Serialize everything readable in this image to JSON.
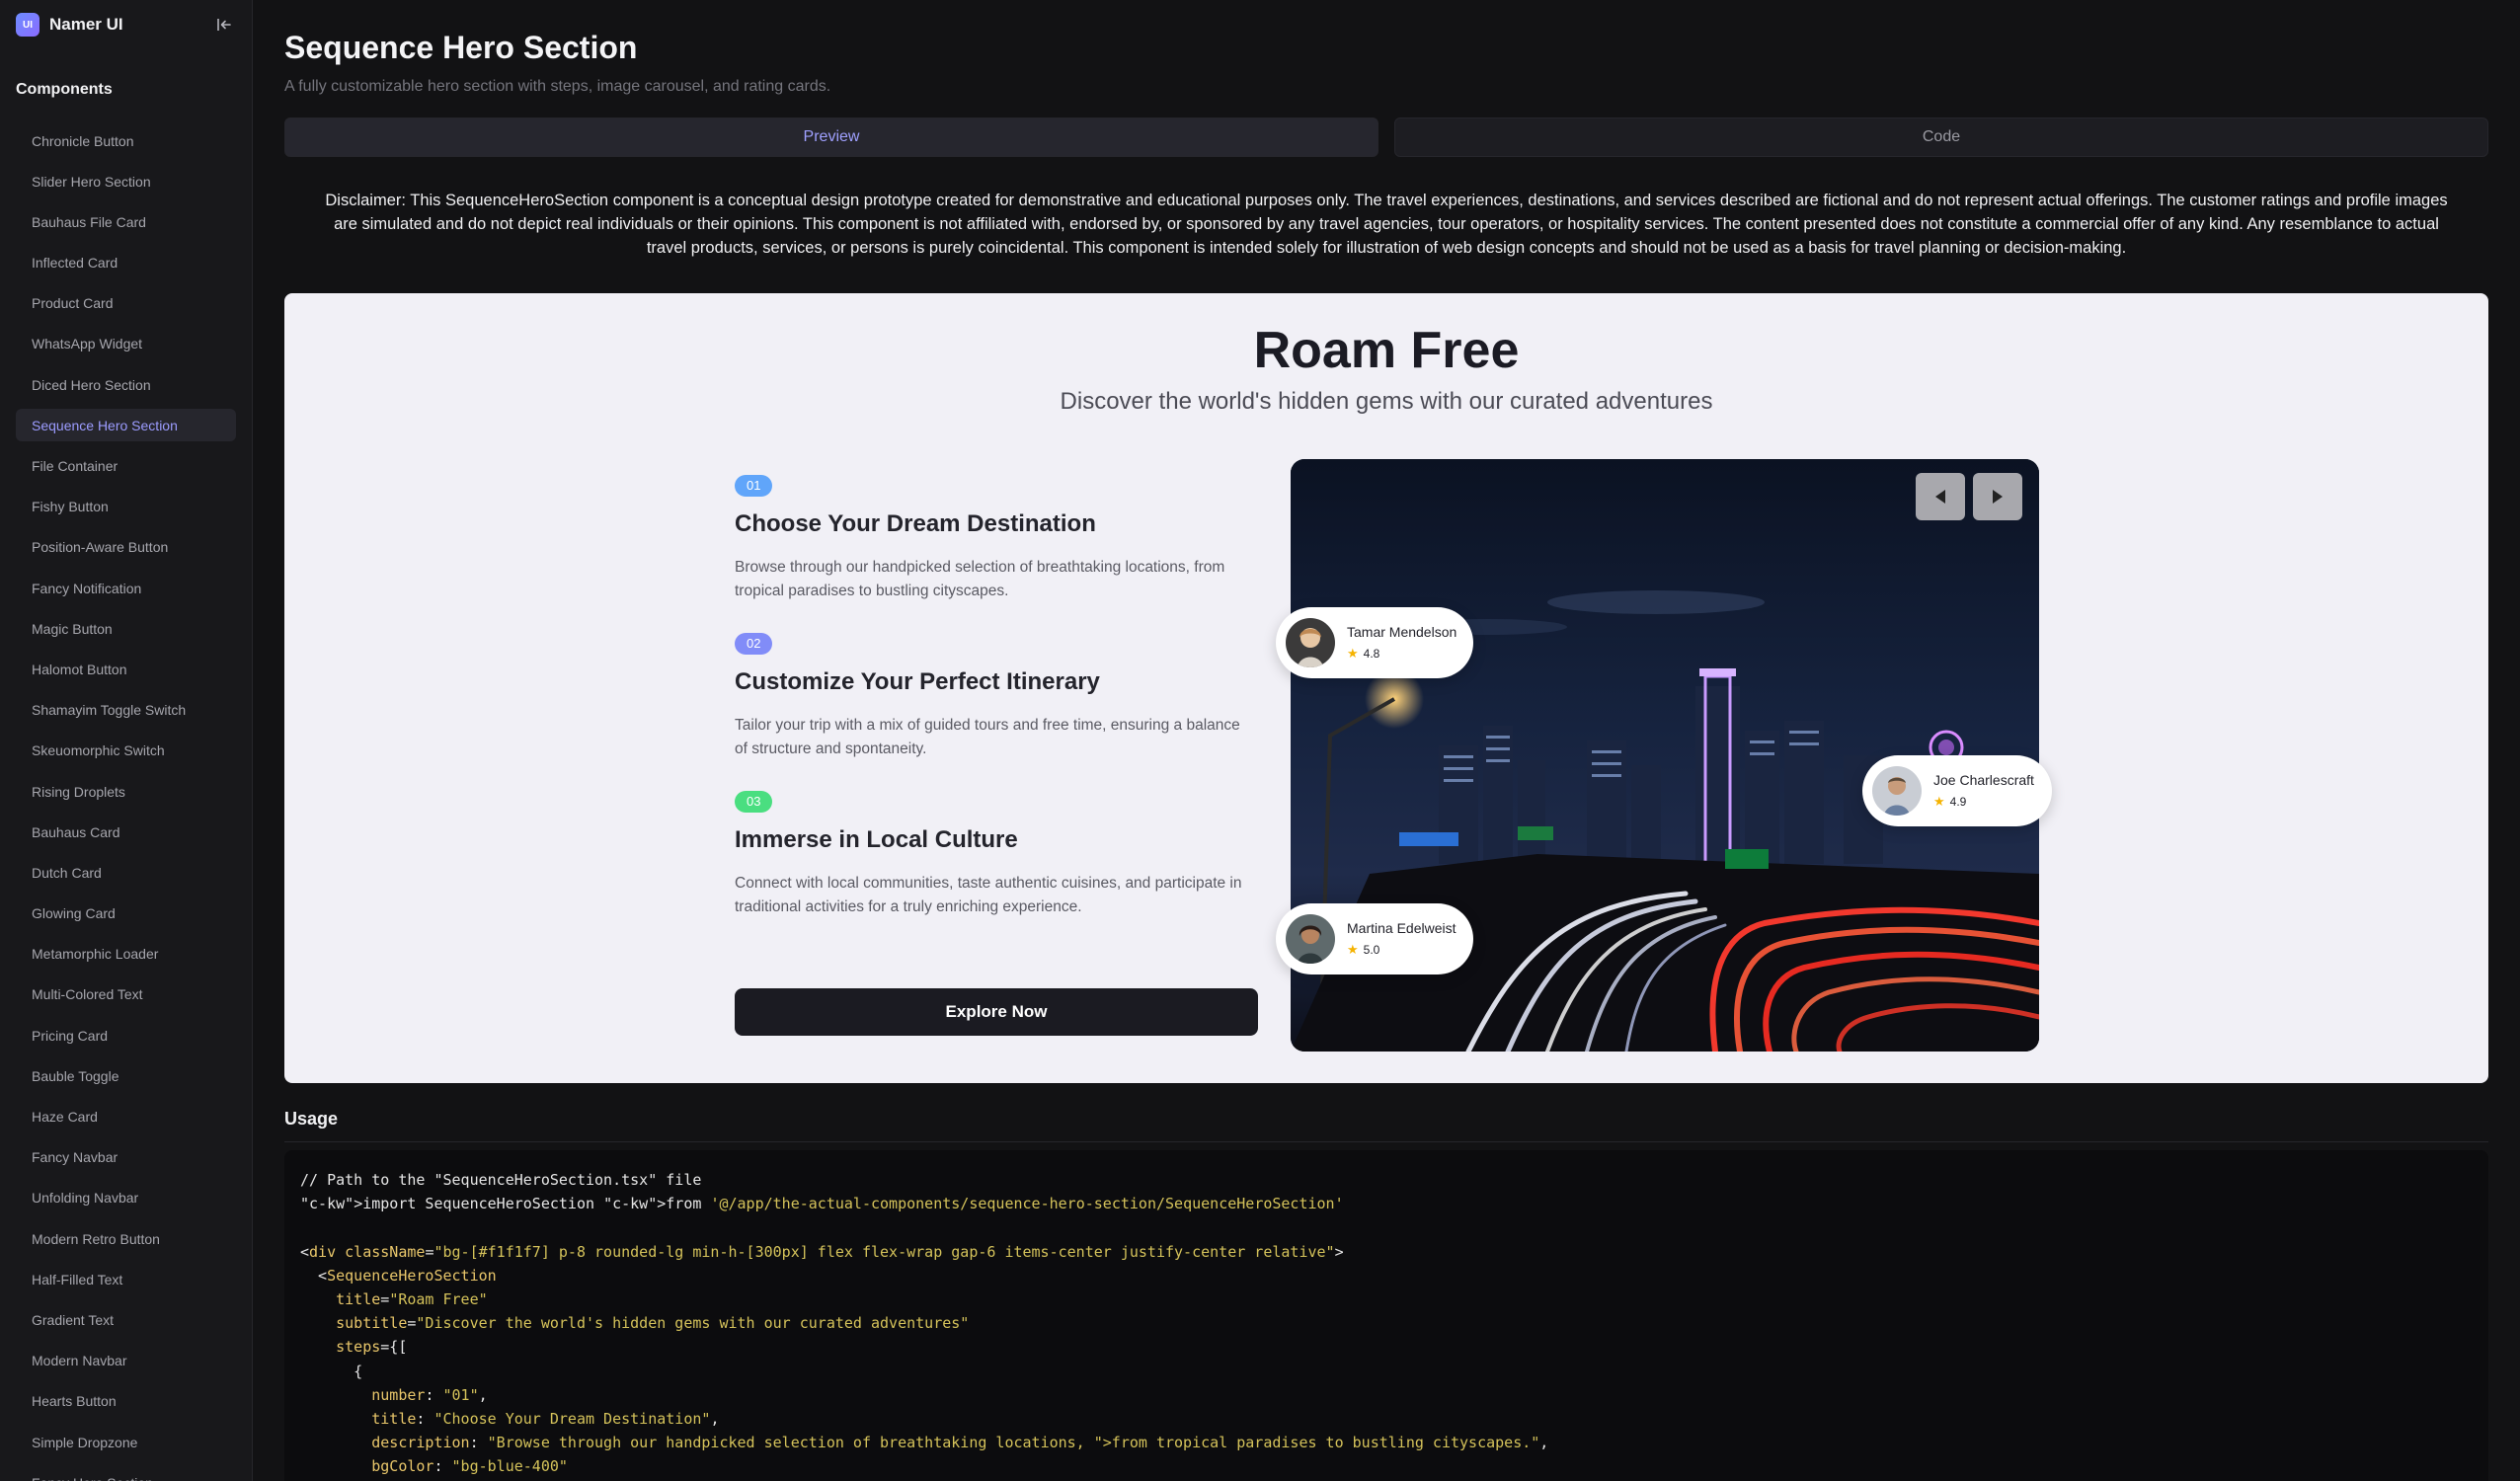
{
  "brand": {
    "name": "Namer UI",
    "logo_text": "UI"
  },
  "sidebar": {
    "section_title": "Components",
    "items": [
      {
        "label": "Chronicle Button"
      },
      {
        "label": "Slider Hero Section"
      },
      {
        "label": "Bauhaus File Card"
      },
      {
        "label": "Inflected Card"
      },
      {
        "label": "Product Card"
      },
      {
        "label": "WhatsApp Widget"
      },
      {
        "label": "Diced Hero Section"
      },
      {
        "label": "Sequence Hero Section",
        "active": true
      },
      {
        "label": "File Container"
      },
      {
        "label": "Fishy Button"
      },
      {
        "label": "Position-Aware Button"
      },
      {
        "label": "Fancy Notification"
      },
      {
        "label": "Magic Button"
      },
      {
        "label": "Halomot Button"
      },
      {
        "label": "Shamayim Toggle Switch"
      },
      {
        "label": "Skeuomorphic Switch"
      },
      {
        "label": "Rising Droplets"
      },
      {
        "label": "Bauhaus Card"
      },
      {
        "label": "Dutch Card"
      },
      {
        "label": "Glowing Card"
      },
      {
        "label": "Metamorphic Loader"
      },
      {
        "label": "Multi-Colored Text"
      },
      {
        "label": "Pricing Card"
      },
      {
        "label": "Bauble Toggle"
      },
      {
        "label": "Haze Card"
      },
      {
        "label": "Fancy Navbar"
      },
      {
        "label": "Unfolding Navbar"
      },
      {
        "label": "Modern Retro Button"
      },
      {
        "label": "Half-Filled Text"
      },
      {
        "label": "Gradient Text"
      },
      {
        "label": "Modern Navbar"
      },
      {
        "label": "Hearts Button"
      },
      {
        "label": "Simple Dropzone"
      },
      {
        "label": "Fancy Hero Section"
      }
    ]
  },
  "page": {
    "title": "Sequence Hero Section",
    "subtitle": "A fully customizable hero section with steps, image carousel, and rating cards.",
    "tabs": [
      {
        "label": "Preview",
        "active": true
      },
      {
        "label": "Code",
        "active": false
      }
    ],
    "disclaimer": "Disclaimer: This SequenceHeroSection component is a conceptual design prototype created for demonstrative and educational purposes only. The travel experiences, destinations, and services described are fictional and do not represent actual offerings. The customer ratings and profile images are simulated and do not depict real individuals or their opinions. This component is not affiliated with, endorsed by, or sponsored by any travel agencies, tour operators, or hospitality services. The content presented does not constitute a commercial offer of any kind. Any resemblance to actual travel products, services, or persons is purely coincidental. This component is intended solely for illustration of web design concepts and should not be used as a basis for travel planning or decision-making."
  },
  "hero": {
    "title": "Roam Free",
    "subtitle": "Discover the world's hidden gems with our curated adventures",
    "steps": [
      {
        "number": "01",
        "title": "Choose Your Dream Destination",
        "description": "Browse through our handpicked selection of breathtaking locations, from tropical paradises to bustling cityscapes.",
        "color": "#60a5fa"
      },
      {
        "number": "02",
        "title": "Customize Your Perfect Itinerary",
        "description": "Tailor your trip with a mix of guided tours and free time, ensuring a balance of structure and spontaneity.",
        "color": "#818cf8"
      },
      {
        "number": "03",
        "title": "Immerse in Local Culture",
        "description": "Connect with local communities, taste authentic cuisines, and participate in traditional activities for a truly enriching experience.",
        "color": "#4ade80"
      }
    ],
    "button_label": "Explore Now",
    "ratings": [
      {
        "name": "Tamar Mendelson",
        "score": "4.8"
      },
      {
        "name": "Joe Charlescraft",
        "score": "4.9"
      },
      {
        "name": "Martina Edelweist",
        "score": "5.0"
      }
    ],
    "icons": {
      "prev": "triangle-left-icon",
      "next": "triangle-right-icon",
      "star": "star-icon"
    }
  },
  "usage": {
    "title": "Usage",
    "code_lines": [
      "// Path to the \"SequenceHeroSection.tsx\" file",
      "import SequenceHeroSection from '@/app/the-actual-components/sequence-hero-section/SequenceHeroSection'",
      "",
      "<div className=\"bg-[#f1f1f7] p-8 rounded-lg min-h-[300px] flex flex-wrap gap-6 items-center justify-center relative\">",
      "  <SequenceHeroSection",
      "    title=\"Roam Free\"",
      "    subtitle=\"Discover the world's hidden gems with our curated adventures\"",
      "    steps={[",
      "      {",
      "        number: \"01\",",
      "        title: \"Choose Your Dream Destination\",",
      "        description: \"Browse through our handpicked selection of breathtaking locations, from tropical paradises to bustling cityscapes.\",",
      "        bgColor: \"bg-blue-400\""
    ]
  }
}
